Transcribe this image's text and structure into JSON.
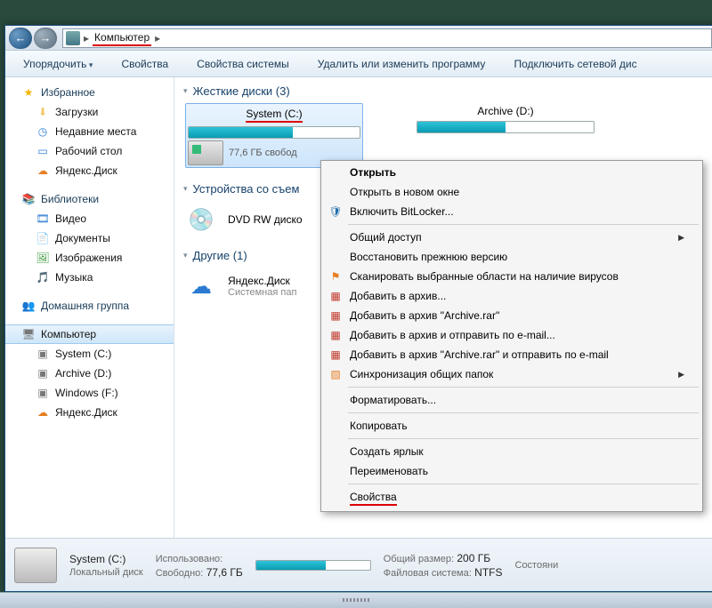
{
  "breadcrumb": {
    "loc": "Компьютер"
  },
  "toolbar": {
    "organize": "Упорядочить",
    "properties": "Свойства",
    "sysprops": "Свойства системы",
    "uninstall": "Удалить или изменить программу",
    "mapnet": "Подключить сетевой дис"
  },
  "sidebar": {
    "fav_hd": "Избранное",
    "fav": [
      "Загрузки",
      "Недавние места",
      "Рабочий стол",
      "Яндекс.Диск"
    ],
    "lib_hd": "Библиотеки",
    "lib": [
      "Видео",
      "Документы",
      "Изображения",
      "Музыка"
    ],
    "home_hd": "Домашняя группа",
    "comp_hd": "Компьютер",
    "comp": [
      "System (C:)",
      "Archive (D:)",
      "Windows (F:)",
      "Яндекс.Диск"
    ]
  },
  "sections": {
    "hdd": "Жесткие диски (3)",
    "removable": "Устройства со съем",
    "other": "Другие (1)"
  },
  "drives": {
    "c": {
      "name": "System (C:)",
      "free": "77,6 ГБ свобод",
      "fill_pct": 61
    },
    "d": {
      "name": "Archive (D:)"
    }
  },
  "dvd": {
    "label": "DVD RW диско"
  },
  "yadisk": {
    "name": "Яндекс.Диск",
    "sub": "Системная пап"
  },
  "context": {
    "open": "Открыть",
    "open_new": "Открыть в новом окне",
    "bitlocker": "Включить BitLocker...",
    "share": "Общий доступ",
    "restore": "Восстановить прежнюю версию",
    "scan": "Сканировать выбранные области на наличие вирусов",
    "add_arch": "Добавить в архив...",
    "add_arch_named": "Добавить в архив \"Archive.rar\"",
    "add_email": "Добавить в архив и отправить по e-mail...",
    "add_email_named": "Добавить в архив \"Archive.rar\" и отправить по e-mail",
    "sync": "Синхронизация общих папок",
    "format": "Форматировать...",
    "copy": "Копировать",
    "shortcut": "Создать ярлык",
    "rename": "Переименовать",
    "props": "Свойства"
  },
  "status": {
    "title": "System (C:)",
    "sub": "Локальный диск",
    "used_l": "Использовано:",
    "free_l": "Свободно:",
    "free_v": "77,6 ГБ",
    "total_l": "Общий размер:",
    "total_v": "200 ГБ",
    "fs_l": "Файловая система:",
    "fs_v": "NTFS",
    "state_l": "Состояни"
  }
}
